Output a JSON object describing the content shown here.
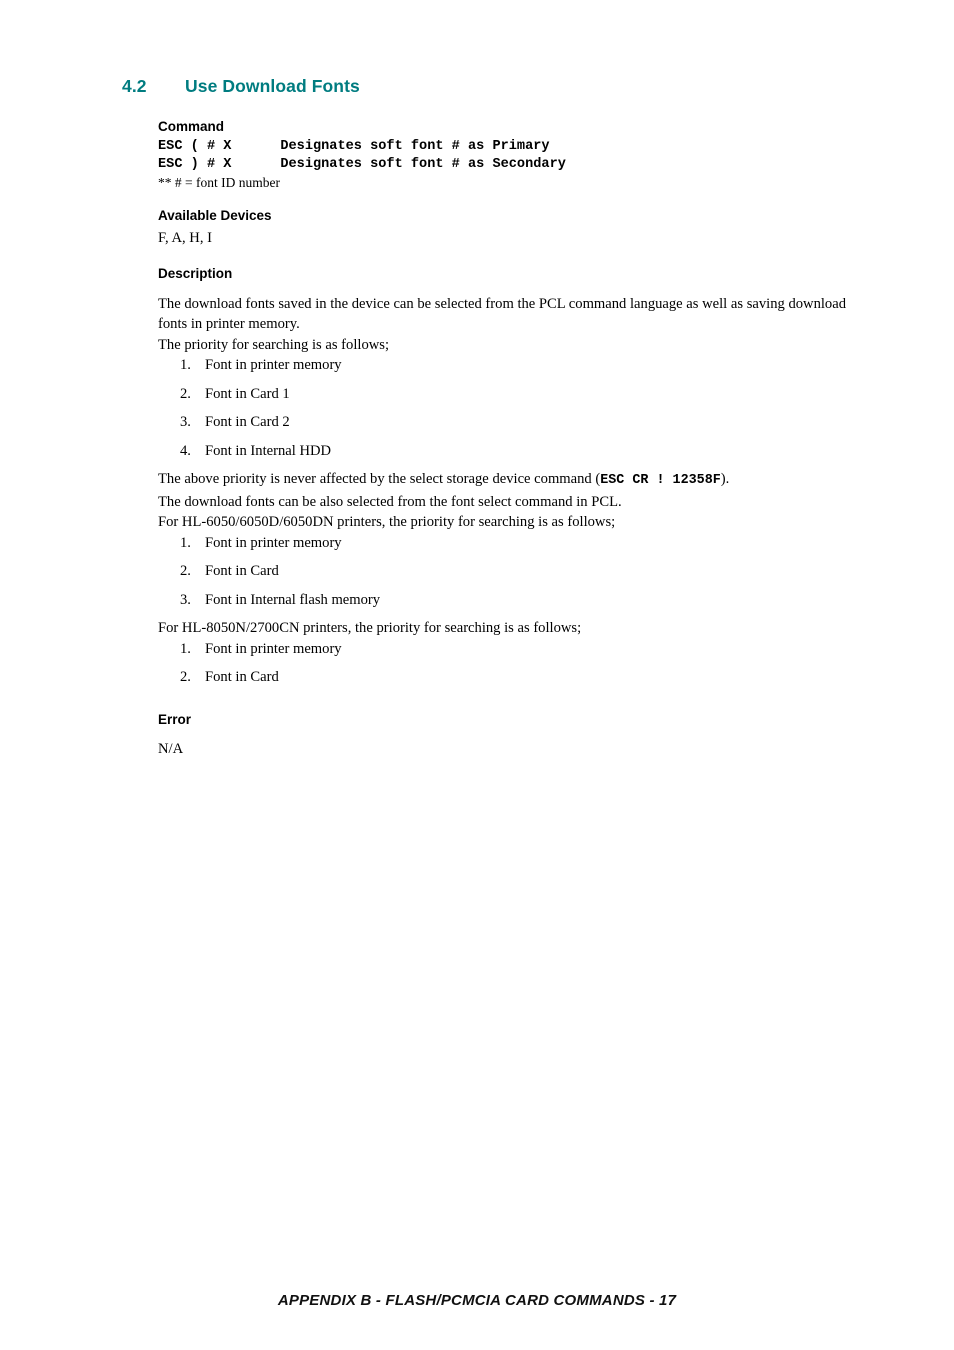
{
  "theme": {
    "heading_color": "#007c80",
    "text_color": "#000000",
    "page_background": "#ffffff"
  },
  "section": {
    "number": "4.2",
    "title": "Use Download Fonts"
  },
  "command": {
    "heading": "Command",
    "lines": "ESC ( # X      Designates soft font # as Primary\nESC ) # X      Designates soft font # as Secondary",
    "footnote": "** # = font ID number"
  },
  "available_devices": {
    "heading": "Available Devices",
    "value": "F, A, H, I"
  },
  "description": {
    "heading": "Description",
    "paragraph_1": "The download fonts saved in the device can be selected from the PCL command language as well as saving download fonts in printer memory.",
    "paragraph_2": "The priority for searching is as follows;",
    "priority_list_1": [
      {
        "num": "1.",
        "text": "Font in printer memory"
      },
      {
        "num": "2.",
        "text": "Font in Card 1"
      },
      {
        "num": "3.",
        "text": "Font in Card 2"
      },
      {
        "num": "4.",
        "text": "Font in Internal HDD"
      }
    ],
    "paragraph_3_prefix": "The above priority is never affected by the select storage device command (",
    "paragraph_3_code": "ESC CR ! 12358F",
    "paragraph_3_suffix": ").",
    "paragraph_4": "The download fonts can be also selected from the font select command in PCL.",
    "paragraph_5": "For HL-6050/6050D/6050DN printers, the priority for searching is as follows;",
    "priority_list_2": [
      {
        "num": "1.",
        "text": "Font in printer memory"
      },
      {
        "num": "2.",
        "text": "Font in Card"
      },
      {
        "num": "3.",
        "text": "Font in Internal flash memory"
      }
    ],
    "paragraph_6": "For HL-8050N/2700CN printers, the priority for searching is as follows;",
    "priority_list_3": [
      {
        "num": "1.",
        "text": "Font in printer memory"
      },
      {
        "num": "2.",
        "text": "Font in Card"
      }
    ]
  },
  "error": {
    "heading": "Error",
    "value": "N/A"
  },
  "footer": {
    "text": "APPENDIX B - FLASH/PCMCIA CARD COMMANDS - 17"
  }
}
